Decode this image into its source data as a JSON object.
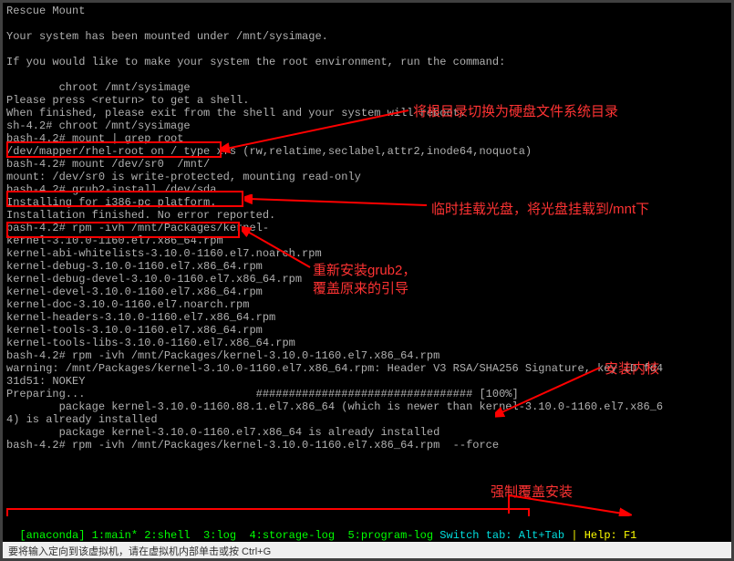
{
  "lines": [
    "Rescue Mount",
    "",
    "Your system has been mounted under /mnt/sysimage.",
    "",
    "If you would like to make your system the root environment, run the command:",
    "",
    "        chroot /mnt/sysimage",
    "Please press <return> to get a shell.",
    "When finished, please exit from the shell and your system will reboot.",
    "sh-4.2# chroot /mnt/sysimage",
    "bash-4.2# mount | grep root",
    "/dev/mapper/rhel-root on / type xfs (rw,relatime,seclabel,attr2,inode64,noquota)",
    "bash-4.2# mount /dev/sr0  /mnt/",
    "mount: /dev/sr0 is write-protected, mounting read-only",
    "bash-4.2# grub2-install /dev/sda",
    "Installing for i386-pc platform.",
    "Installation finished. No error reported.",
    "bash-4.2# rpm -ivh /mnt/Packages/kernel-",
    "kernel-3.10.0-1160.el7.x86_64.rpm",
    "kernel-abi-whitelists-3.10.0-1160.el7.noarch.rpm",
    "kernel-debug-3.10.0-1160.el7.x86_64.rpm",
    "kernel-debug-devel-3.10.0-1160.el7.x86_64.rpm",
    "kernel-devel-3.10.0-1160.el7.x86_64.rpm",
    "kernel-doc-3.10.0-1160.el7.noarch.rpm",
    "kernel-headers-3.10.0-1160.el7.x86_64.rpm",
    "kernel-tools-3.10.0-1160.el7.x86_64.rpm",
    "kernel-tools-libs-3.10.0-1160.el7.x86_64.rpm",
    "bash-4.2# rpm -ivh /mnt/Packages/kernel-3.10.0-1160.el7.x86_64.rpm",
    "warning: /mnt/Packages/kernel-3.10.0-1160.el7.x86_64.rpm: Header V3 RSA/SHA256 Signature, key ID fd4",
    "31d51: NOKEY",
    "Preparing...                          ################################# [100%]",
    "        package kernel-3.10.0-1160.88.1.el7.x86_64 (which is newer than kernel-3.10.0-1160.el7.x86_6",
    "4) is already installed",
    "        package kernel-3.10.0-1160.el7.x86_64 is already installed",
    "bash-4.2# rpm -ivh /mnt/Packages/kernel-3.10.0-1160.el7.x86_64.rpm  --force"
  ],
  "annotations": {
    "a1": "将根目录切换为硬盘文件系统目录",
    "a2": "临时挂载光盘，将光盘挂载到/mnt下",
    "a3": "重新安装grub2，",
    "a3b": "覆盖原来的引导",
    "a4": "安装内核",
    "a5": "强制覆盖安装"
  },
  "status": {
    "left": "[anaconda] 1:main* 2:shell  3:log  4:storage-log  5:program-log",
    "switch": " Switch tab: Alt+Tab ",
    "help": "| Help: F1 "
  },
  "hint": "要将输入定向到该虚拟机，请在虚拟机内部单击或按 Ctrl+G"
}
